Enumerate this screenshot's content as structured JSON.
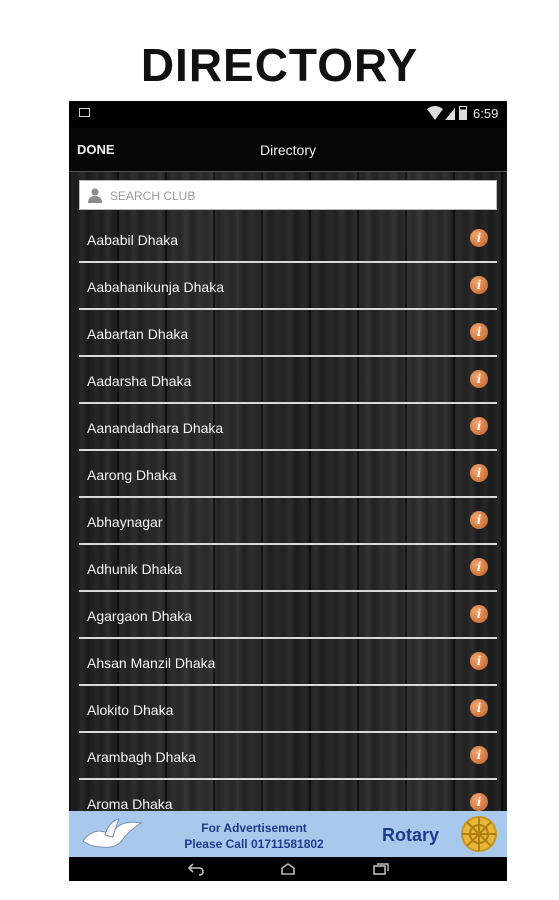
{
  "page": {
    "heading": "DIRECTORY"
  },
  "status_bar": {
    "time": "6:59"
  },
  "app_bar": {
    "done_label": "DONE",
    "title": "Directory"
  },
  "search": {
    "placeholder": "SEARCH CLUB",
    "value": ""
  },
  "clubs": [
    {
      "name": "Aababil Dhaka"
    },
    {
      "name": "Aabahanikunja Dhaka"
    },
    {
      "name": "Aabartan Dhaka"
    },
    {
      "name": "Aadarsha Dhaka"
    },
    {
      "name": "Aanandadhara Dhaka"
    },
    {
      "name": "Aarong Dhaka"
    },
    {
      "name": "Abhaynagar"
    },
    {
      "name": "Adhunik Dhaka"
    },
    {
      "name": "Agargaon Dhaka"
    },
    {
      "name": "Ahsan Manzil Dhaka"
    },
    {
      "name": "Alokito Dhaka"
    },
    {
      "name": "Arambagh Dhaka"
    },
    {
      "name": "Aroma Dhaka"
    }
  ],
  "info_icon": {
    "name": "info-icon",
    "glyph": "i",
    "color": "#d9773d"
  },
  "advertisement": {
    "line1": "For Advertisement",
    "line2": "Please Call 01711581802",
    "brand": "Rotary",
    "background": "#a9c9ec"
  },
  "nav_bar": {
    "icons": [
      "back-icon",
      "home-icon",
      "recents-icon"
    ]
  }
}
